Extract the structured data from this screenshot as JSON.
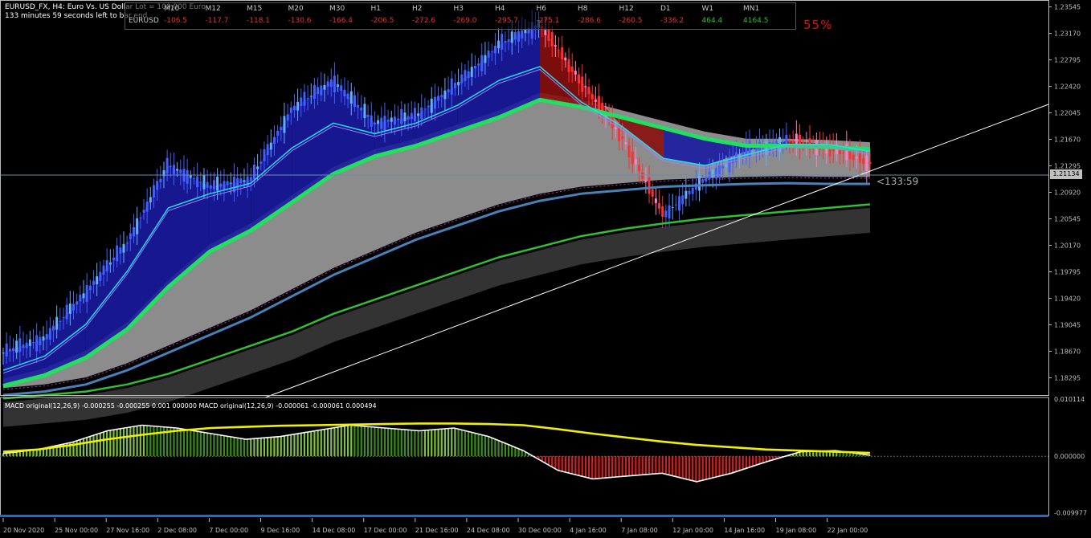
{
  "header": {
    "title_line": "EURUSD_FX, H4:  Euro Vs. US Dollar  Lot = 100,000 Euro",
    "timer_line": "133 minutes 59 seconds left to bar end"
  },
  "multi_timeframe_panel": {
    "symbol": "EURUSD",
    "timeframes": [
      "M10",
      "M12",
      "M15",
      "M20",
      "M30",
      "H1",
      "H2",
      "H3",
      "H4",
      "H6",
      "H8",
      "H12",
      "D1",
      "W1",
      "MN1"
    ],
    "values": [
      "-106.5",
      "-117.7",
      "-118.1",
      "-130.6",
      "-166.4",
      "-206.5",
      "-272.6",
      "-269.0",
      "-295.7",
      "-275.1",
      "-286.6",
      "-260.5",
      "-336.2",
      "464.4",
      "4164.5"
    ],
    "negative_color": "#e83030",
    "positive_color": "#30c030"
  },
  "signal_percent": "55%",
  "current_price_label": "1.21134",
  "countdown_label": "<133:59",
  "indicator_label": "MACD original(12,26,9) -0.000255 -0.000255 0.001 000000 MACD original(12,26,9) -0.000061 -0.000061 0.000494",
  "colors": {
    "background": "#000000",
    "bull_body": "#4060ff",
    "bear_body": "#ff3030",
    "ribbon_bull": "#1a1aa0",
    "ribbon_bear": "#8a0e0e",
    "ema_cyan": "#20e0f0",
    "ema_green": "#20e060",
    "ma_steel": "#4a80b8",
    "ma_slow_green": "#30c030",
    "band_gray": "#8c8c8c",
    "band_dark": "#333333",
    "macd_line": "#ffffff",
    "signal_line": "#f0f000",
    "hist_pos": "#7fc040",
    "hist_neg": "#d02020",
    "grid_text": "#c0c0c0"
  },
  "chart_data": [
    {
      "type": "line",
      "name": "main",
      "x": [
        "20 Nov 2020",
        "25 Nov 00:00",
        "27 Nov 16:00",
        "2 Dec 08:00",
        "7 Dec 00:00",
        "9 Dec 16:00",
        "14 Dec 08:00",
        "17 Dec 00:00",
        "21 Dec 16:00",
        "24 Dec 08:00",
        "30 Dec 00:00",
        "4 Jan 16:00",
        "7 Jan 08:00",
        "12 Jan 00:00",
        "14 Jan 16:00",
        "19 Jan 08:00",
        "22 Jan 00:00"
      ],
      "y_ticks": [
        "1.23545",
        "1.23170",
        "1.22795",
        "1.22420",
        "1.22045",
        "1.21670",
        "1.21295",
        "1.20920",
        "1.20545",
        "1.20170",
        "1.19795",
        "1.19420",
        "1.19045",
        "1.18670",
        "1.18295"
      ],
      "ylim": [
        1.1805,
        1.2362
      ],
      "series": [
        {
          "values": [
            1.1865,
            1.1885,
            1.195,
            1.202,
            1.213,
            1.21,
            1.211,
            1.221,
            1.225,
            1.219,
            1.22,
            1.2245,
            1.23,
            1.233,
            1.225,
            1.217,
            1.206,
            1.211,
            1.215,
            1.2165,
            1.2155,
            1.2134
          ]
        },
        {
          "values": [
            1.184,
            1.186,
            1.1905,
            1.198,
            1.207,
            1.209,
            1.2105,
            1.2155,
            1.219,
            1.2175,
            1.219,
            1.2215,
            1.225,
            1.227,
            1.222,
            1.2185,
            1.214,
            1.213,
            1.2145,
            1.216,
            1.216,
            1.215
          ]
        },
        {
          "values": [
            1.182,
            1.1835,
            1.186,
            1.19,
            1.196,
            1.201,
            1.204,
            1.208,
            1.212,
            1.2145,
            1.216,
            1.218,
            1.22,
            1.2225,
            1.2215,
            1.22,
            1.2185,
            1.217,
            1.216,
            1.216,
            1.2158,
            1.2155
          ]
        },
        {
          "values": [
            1.1805,
            1.181,
            1.182,
            1.184,
            1.1865,
            1.189,
            1.1915,
            1.1945,
            1.1975,
            1.2,
            1.2025,
            1.2045,
            1.2065,
            1.208,
            1.209,
            1.2095,
            1.21,
            1.2102,
            1.2104,
            1.2105,
            1.2104,
            1.2104
          ]
        },
        {
          "values": [
            1.18,
            1.1805,
            1.181,
            1.182,
            1.1835,
            1.1855,
            1.1875,
            1.1895,
            1.192,
            1.194,
            1.196,
            1.198,
            1.2,
            1.2015,
            1.203,
            1.204,
            1.2048,
            1.2055,
            1.206,
            1.2065,
            1.207,
            1.2075
          ]
        }
      ]
    },
    {
      "type": "bar",
      "name": "MACD",
      "y_ticks": [
        "0.010114",
        "0.000000",
        "-0.009977"
      ],
      "ylim": [
        -0.0102,
        0.0104
      ],
      "series": [
        {
          "values": [
            0.0005,
            0.0012,
            0.0025,
            0.0045,
            0.0055,
            0.005,
            0.004,
            0.003,
            0.0035,
            0.0045,
            0.0055,
            0.005,
            0.0045,
            0.005,
            0.0035,
            0.001,
            -0.0025,
            -0.004,
            -0.0035,
            -0.003,
            -0.0045,
            -0.003,
            -0.001,
            0.0008,
            0.001,
            0.0002
          ]
        },
        {
          "values": [
            0.0008,
            0.0012,
            0.002,
            0.003,
            0.0038,
            0.0045,
            0.005,
            0.0052,
            0.0054,
            0.0055,
            0.0056,
            0.0057,
            0.0058,
            0.0058,
            0.0057,
            0.0055,
            0.0048,
            0.004,
            0.0033,
            0.0026,
            0.002,
            0.0016,
            0.0012,
            0.001,
            0.0008,
            0.0006
          ]
        }
      ]
    }
  ]
}
